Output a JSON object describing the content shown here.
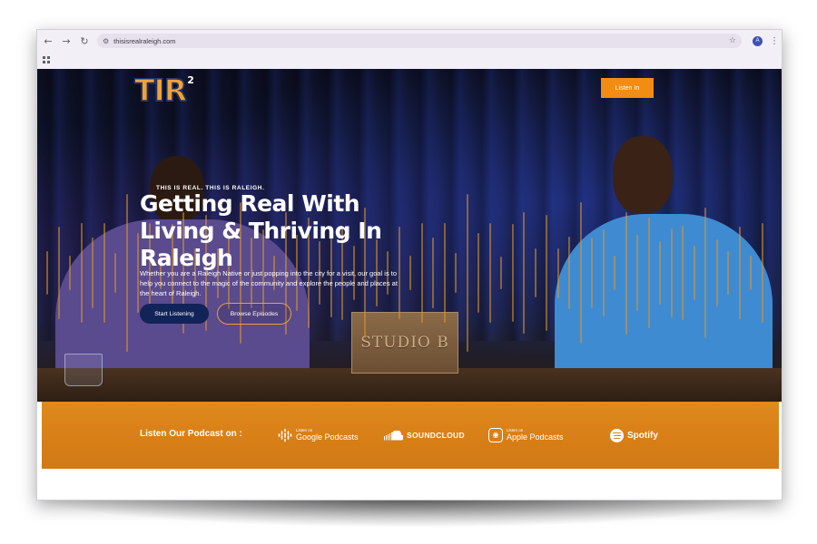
{
  "browser": {
    "url": "thisisrealraleigh.com",
    "profile_initial": "A"
  },
  "header": {
    "logo_text": "TIR",
    "logo_superscript": "2",
    "listen_button": "Listen In"
  },
  "hero": {
    "eyebrow": "THIS IS REAL. THIS IS RALEIGH.",
    "headline": "Getting Real With Living & Thriving In Raleigh",
    "description": "Whether you are a Raleigh Native or just popping into the city for a visit, our goal is to help you connect to the magic of the community and explore the people and places at the heart of Raleigh.",
    "primary_button": "Start Listening",
    "secondary_button": "Browse Episodes",
    "sign_text": "STUDIO B"
  },
  "platforms": {
    "label": "Listen Our Podcast on :",
    "items": [
      {
        "small": "Listen on",
        "name": "Google Podcasts",
        "icon": "google-podcasts-icon"
      },
      {
        "name": "SOUNDCLOUD",
        "icon": "soundcloud-icon"
      },
      {
        "small": "Listen on",
        "name": "Apple Podcasts",
        "icon": "apple-podcasts-icon"
      },
      {
        "name": "Spotify",
        "icon": "spotify-icon"
      }
    ]
  },
  "colors": {
    "accent_orange": "#f28c12",
    "navy": "#12235a",
    "band_orange": "#d98318"
  }
}
